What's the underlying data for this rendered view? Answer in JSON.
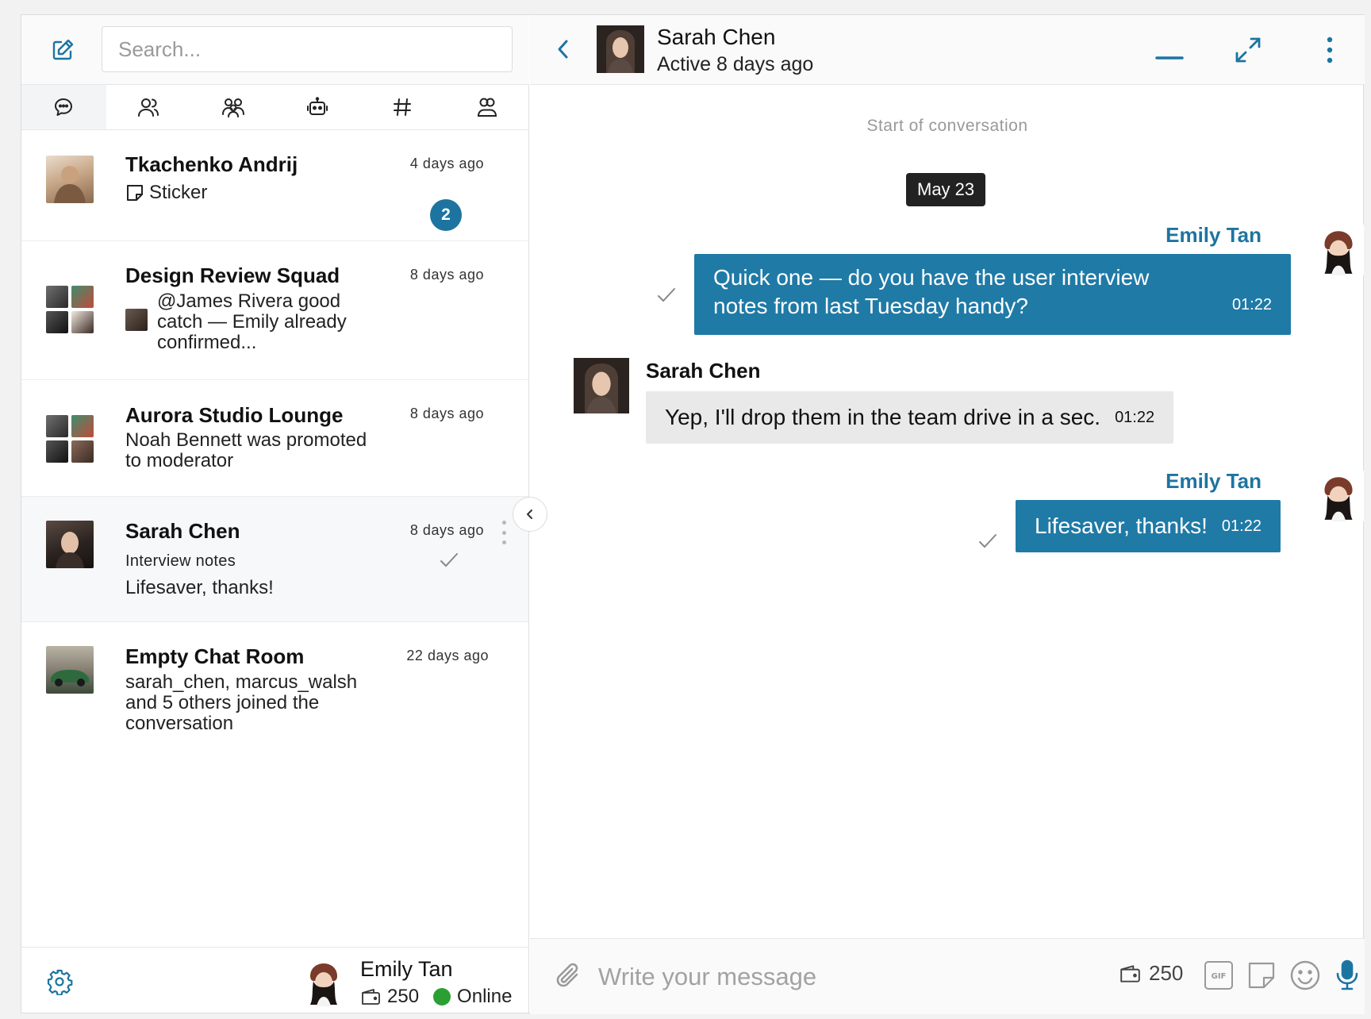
{
  "search": {
    "placeholder": "Search..."
  },
  "tabs": [
    {
      "icon": "chat-bubble-icon",
      "active": true
    },
    {
      "icon": "contacts-icon"
    },
    {
      "icon": "groups-icon"
    },
    {
      "icon": "bot-icon"
    },
    {
      "icon": "hashtag-icon"
    },
    {
      "icon": "user-group-icon"
    }
  ],
  "conversations": [
    {
      "title": "Tkachenko Andrij",
      "time": "4 days ago",
      "preview": "Sticker",
      "unread": "2"
    },
    {
      "title": "Design Review Squad",
      "time": "8 days ago",
      "preview": "@James Rivera good catch — Emily already confirmed..."
    },
    {
      "title": "Aurora Studio Lounge",
      "time": "8 days ago",
      "preview": "Noah Bennett was promoted to moderator"
    },
    {
      "title": "Sarah Chen",
      "time": "8 days ago",
      "subtitle": "Interview notes",
      "preview": "Lifesaver, thanks!"
    },
    {
      "title": "Empty Chat Room",
      "time": "22 days ago",
      "preview": "sarah_chen, marcus_walsh and 5 others joined the conversation"
    }
  ],
  "me": {
    "name": "Emily Tan",
    "coins": "250",
    "status": "Online"
  },
  "chat": {
    "name": "Sarah Chen",
    "status": "Active 8 days ago",
    "start_label": "Start of conversation",
    "date": "May 23",
    "messages": [
      {
        "sender": "Emily Tan",
        "text": "Quick one — do you have the user interview notes from last Tuesday handy?",
        "time": "01:22"
      },
      {
        "sender": "Sarah Chen",
        "text": "Yep, I'll drop them in the team drive in a sec.",
        "time": "01:22"
      },
      {
        "sender": "Emily Tan",
        "text": "Lifesaver, thanks!",
        "time": "01:22"
      }
    ]
  },
  "composer": {
    "placeholder": "Write your message",
    "coins": "250"
  },
  "colors": {
    "accent": "#1d74a0",
    "bubble_me": "#1f7aa6",
    "bubble_them": "#e9e9e9",
    "online": "#2aa033"
  }
}
